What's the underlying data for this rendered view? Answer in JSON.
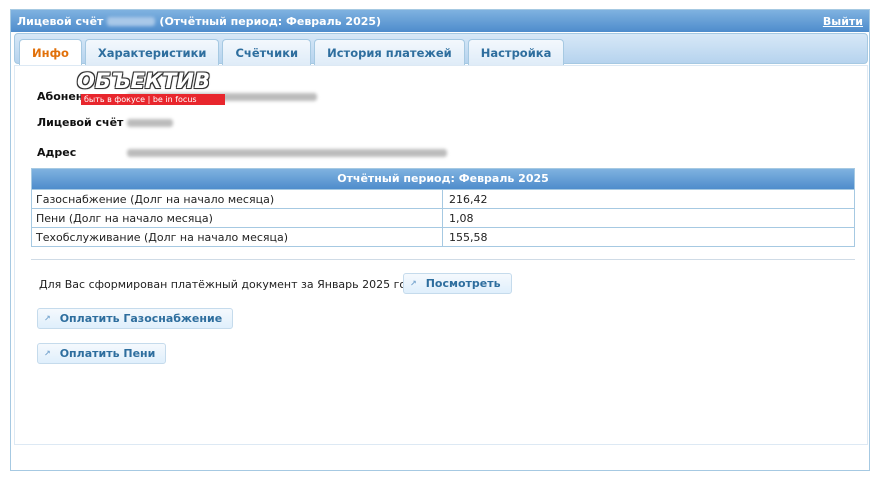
{
  "header": {
    "account_label": "Лицевой счёт",
    "period_text": "(Отчётный период: Февраль 2025)",
    "logout": "Выйти"
  },
  "tabs": [
    {
      "label": "Инфо",
      "active": true
    },
    {
      "label": "Характеристики"
    },
    {
      "label": "Счётчики"
    },
    {
      "label": "История платежей"
    },
    {
      "label": "Настройка"
    }
  ],
  "watermark": {
    "logo_text": "ОБЪЕКТИВ",
    "slogan": "быть в фокусе | be in focus"
  },
  "info": {
    "subscriber_label": "Абонент",
    "account_label": "Лицевой счёт",
    "address_label": "Адрес"
  },
  "period_table": {
    "title": "Отчётный период: Февраль 2025",
    "rows": [
      {
        "name": "Газоснабжение (Долг на начало месяца)",
        "value": "216,42"
      },
      {
        "name": "Пени (Долг на начало месяца)",
        "value": "1,08"
      },
      {
        "name": "Техобслуживание (Долг на начало месяца)",
        "value": "155,58"
      }
    ]
  },
  "notice": {
    "text": "Для Вас сформирован платёжный документ за Январь 2025 года",
    "view_button": "Посмотреть"
  },
  "actions": {
    "pay_gas": "Оплатить Газоснабжение",
    "pay_penalty": "Оплатить Пени"
  },
  "colors": {
    "header_blue": "#4e8ccc",
    "active_tab": "#e17009",
    "link_blue": "#2e6e9e"
  },
  "icons": {
    "button_icon": "external-link-icon"
  }
}
